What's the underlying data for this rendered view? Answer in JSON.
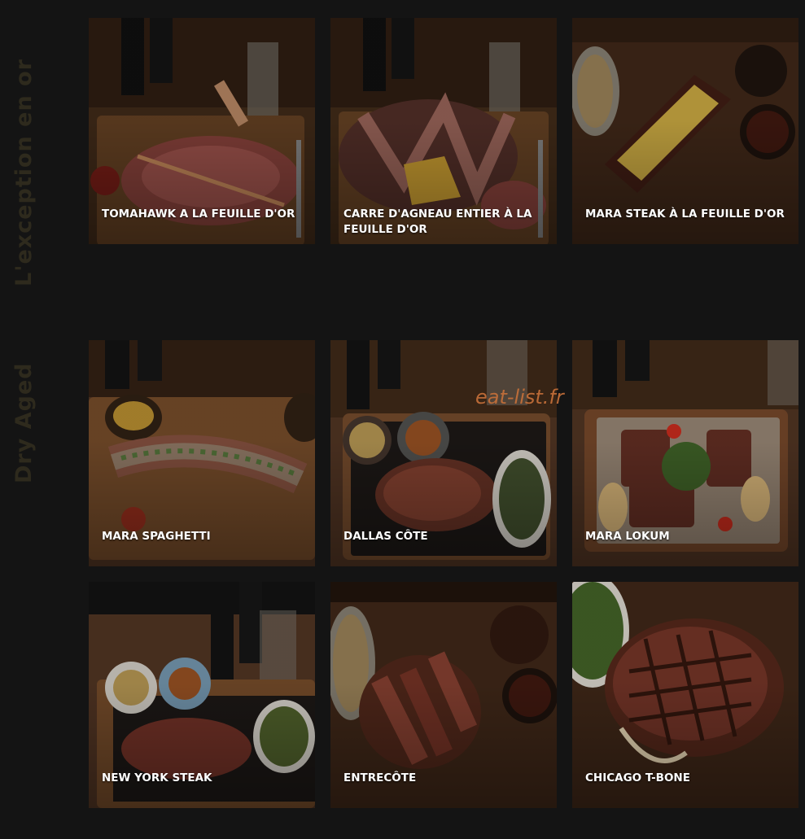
{
  "sections": {
    "gold": {
      "label": "L'exception en or"
    },
    "dry_aged": {
      "label": "Dry Aged"
    }
  },
  "gold_items": [
    {
      "title": "TOMAHAWK A LA FEUILLE D'OR"
    },
    {
      "title": "CARRE D'AGNEAU ENTIER À LA FEUILLE D'OR"
    },
    {
      "title": "MARA STEAK À LA FEUILLE D'OR"
    }
  ],
  "dry_aged_items": [
    {
      "title": "MARA SPAGHETTI"
    },
    {
      "title": "DALLAS CÔTE"
    },
    {
      "title": "MARA LOKUM"
    },
    {
      "title": "NEW YORK STEAK"
    },
    {
      "title": "ENTRECÔTE"
    },
    {
      "title": "CHICAGO T-BONE"
    }
  ],
  "watermark": {
    "text": "eat-list.fr"
  },
  "colors": {
    "background": "#141414",
    "section_label": "#2e2a1d",
    "card_title": "#ffffff",
    "watermark": "#c8713a"
  }
}
